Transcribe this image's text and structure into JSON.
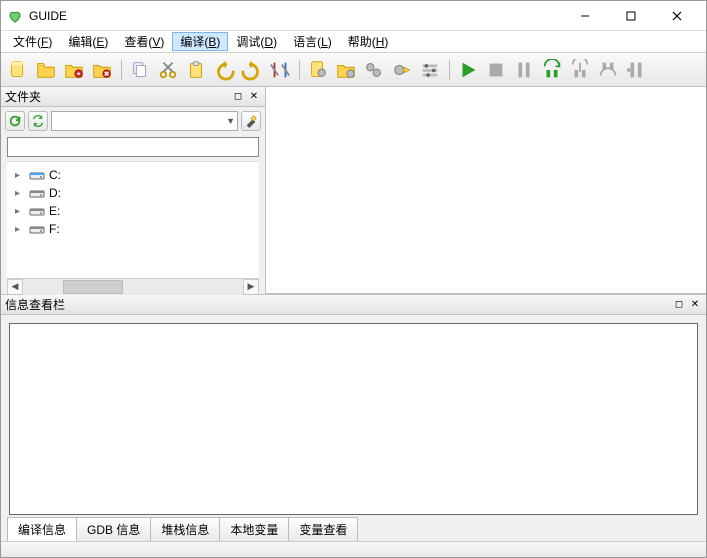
{
  "title": "GUIDE",
  "menus": [
    {
      "label": "文件",
      "key": "F",
      "active": false
    },
    {
      "label": "编辑",
      "key": "E",
      "active": false
    },
    {
      "label": "查看",
      "key": "V",
      "active": false
    },
    {
      "label": "编译",
      "key": "B",
      "active": true
    },
    {
      "label": "调试",
      "key": "D",
      "active": false
    },
    {
      "label": "语言",
      "key": "L",
      "active": false
    },
    {
      "label": "帮助",
      "key": "H",
      "active": false
    }
  ],
  "left_panel": {
    "title": "文件夹",
    "filter_value": "",
    "drives": [
      "C:",
      "D:",
      "E:",
      "F:"
    ]
  },
  "info_panel": {
    "title": "信息查看栏",
    "tabs": [
      "编译信息",
      "GDB 信息",
      "堆栈信息",
      "本地变量",
      "变量查看"
    ],
    "active_tab": 0
  },
  "toolbar_names": [
    "new-file",
    "open-file",
    "save-file",
    "close-file",
    "copy",
    "cut",
    "paste",
    "undo",
    "redo",
    "settings",
    "compile",
    "build",
    "cogs",
    "gear-run",
    "switches",
    "run",
    "stop",
    "pause",
    "step-over",
    "step-into",
    "step-out",
    "step-return"
  ]
}
